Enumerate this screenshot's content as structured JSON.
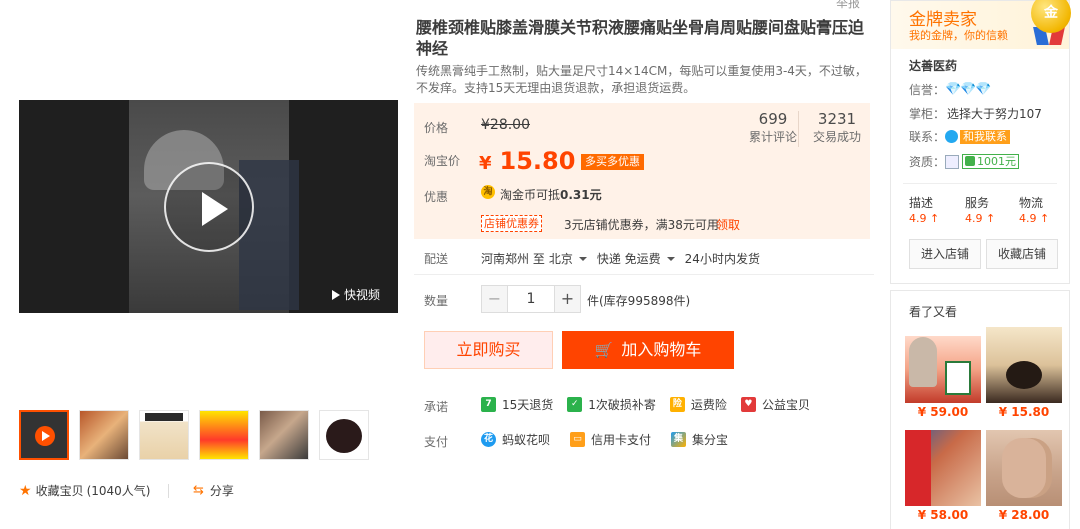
{
  "top": {
    "report_label": "举报"
  },
  "product": {
    "title": "腰椎颈椎贴膝盖滑膜关节积液腰痛贴坐骨肩周贴腰间盘贴膏压迫神经",
    "subtitle": "传统黑膏纯手工熬制，贴大量足尺寸14×14CM，每贴可以重复使用3-4天，不过敏，不发痒。支持15天无理由退货退款，承担退货运费。"
  },
  "media": {
    "video_tag": "快视频",
    "thumbnail_count": 6,
    "favorite_label": "收藏宝贝",
    "favorite_count": "(1040人气)",
    "share_label": "分享"
  },
  "price": {
    "price_label": "价格",
    "original_price": "¥28.00",
    "taobao_price_label": "淘宝价",
    "currency": "¥",
    "current_price": "15.80",
    "more_deals": "多买多优惠",
    "reviews_count": "699",
    "reviews_label": "累计评论",
    "sales_count": "3231",
    "sales_label": "交易成功",
    "discount_label": "优惠",
    "coin_text": "淘金币可抵",
    "coin_amount": "0.31元",
    "coupon_tag": "店铺优惠券",
    "coupon_text": "3元店铺优惠券，满38元可用",
    "coupon_get": "领取"
  },
  "shipping": {
    "label": "配送",
    "from": "河南郑州 至",
    "to": "北京",
    "method": "快递 免运费",
    "dispatch": "24小时内发货"
  },
  "quantity": {
    "label": "数量",
    "minus": "−",
    "value": "1",
    "plus": "+",
    "stock": "件(库存995898件)"
  },
  "actions": {
    "buy_now": "立即购买",
    "add_to_cart": "加入购物车"
  },
  "promises": {
    "label": "承诺",
    "items": [
      {
        "icon": "return-7-icon",
        "text": "15天退货",
        "color": "#2bb24c"
      },
      {
        "icon": "shield-icon",
        "text": "1次破损补寄",
        "color": "#2bb24c"
      },
      {
        "icon": "insurance-icon",
        "text": "运费险",
        "color": "#ffb100"
      },
      {
        "icon": "charity-icon",
        "text": "公益宝贝",
        "color": "#e23a3a"
      }
    ]
  },
  "payment": {
    "label": "支付",
    "items": [
      {
        "icon": "huabei-icon",
        "text": "蚂蚁花呗",
        "color": "#1e9bf0"
      },
      {
        "icon": "credit-card-icon",
        "text": "信用卡支付",
        "color": "#ff9f1a"
      },
      {
        "icon": "jifenbao-icon",
        "text": "集分宝",
        "color": "#1e9bf0"
      }
    ]
  },
  "shop": {
    "badge_title": "金牌卖家",
    "badge_sub": "我的金牌，你的信赖",
    "medal_text": "金",
    "name": "达善医药",
    "rep_label": "信誉：",
    "rep_value": "💎💎💎",
    "keeper_label": "掌柜：",
    "keeper_value": "选择大于努力107",
    "contact_label": "联系：",
    "contact_btn": "和我联系",
    "qual_label": "资质：",
    "qual_value": "1001元",
    "scores": [
      {
        "k": "描述",
        "v": "4.9 ↑"
      },
      {
        "k": "服务",
        "v": "4.9 ↑"
      },
      {
        "k": "物流",
        "v": "4.9 ↑"
      }
    ],
    "enter_shop": "进入店铺",
    "collect_shop": "收藏店铺"
  },
  "also_viewed": {
    "title": "看了又看",
    "items": [
      {
        "price": "¥ 59.00"
      },
      {
        "price": "¥ 15.80"
      },
      {
        "price": "¥ 58.00"
      },
      {
        "price": "¥ 28.00"
      }
    ]
  }
}
